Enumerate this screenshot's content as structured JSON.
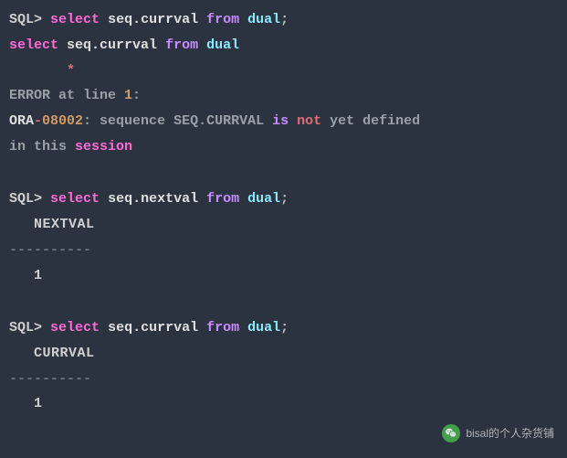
{
  "prompt": "SQL>",
  "kw": {
    "select": "select",
    "from": "from",
    "is": "is",
    "not": "not",
    "session": "session"
  },
  "q1": {
    "expr": "seq.currval",
    "table": "dual",
    "semi": ";"
  },
  "echo1": {
    "expr": "seq.currval",
    "table": "dual"
  },
  "star_line": "       *",
  "error_at": "ERROR at line ",
  "error_line_num": "1",
  "error_colon": ":",
  "ora_prefix": "ORA",
  "ora_dash": "-",
  "ora_code": "08002",
  "err_mid": ": sequence SEQ.CURRVAL ",
  "err_yet": " yet defined",
  "err_in_this": "in this ",
  "q2": {
    "expr": "seq.nextval",
    "table": "dual",
    "semi": ";"
  },
  "col2": "NEXTVAL",
  "dashes": "----------",
  "val2": "1",
  "q3": {
    "expr": "seq.currval",
    "table": "dual",
    "semi": ";"
  },
  "col3": "CURRVAL",
  "val3": "1",
  "watermark_text": "bisal的个人杂货铺"
}
